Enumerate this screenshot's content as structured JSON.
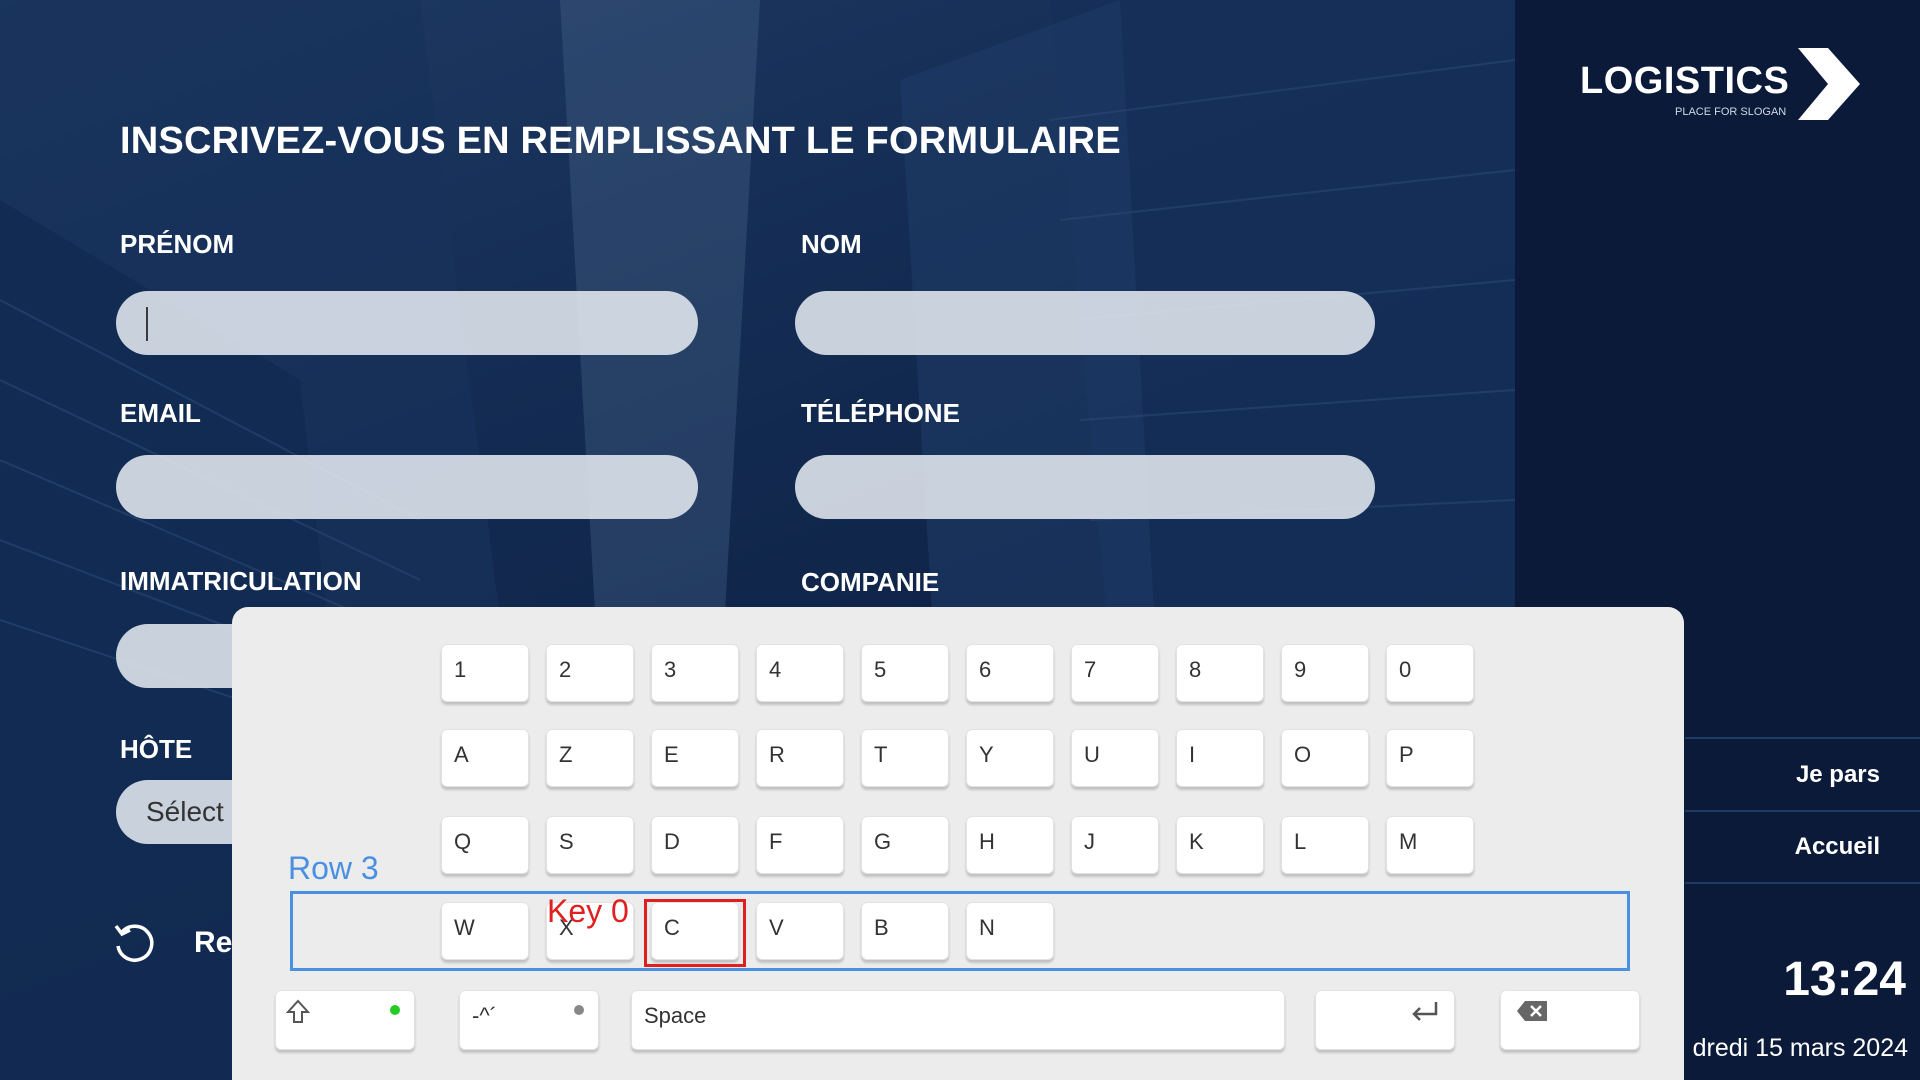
{
  "brand": {
    "name": "LOGISTICS",
    "slogan": "PLACE FOR SLOGAN"
  },
  "form": {
    "title": "INSCRIVEZ-VOUS EN REMPLISSANT LE FORMULAIRE",
    "labels": {
      "prenom": "PRÉNOM",
      "nom": "NOM",
      "email": "EMAIL",
      "telephone": "TÉLÉPHONE",
      "immatriculation": "IMMATRICULATION",
      "companie": "COMPANIE",
      "hote": "HÔTE"
    },
    "host_select_value": "Sélect",
    "reset_label": "Re"
  },
  "sidebar": {
    "links": [
      "Je pars",
      "Accueil"
    ],
    "time": "13:24",
    "date": "dredi 15 mars 2024"
  },
  "keyboard": {
    "row0": [
      "1",
      "2",
      "3",
      "4",
      "5",
      "6",
      "7",
      "8",
      "9",
      "0"
    ],
    "row1": [
      "A",
      "Z",
      "E",
      "R",
      "T",
      "Y",
      "U",
      "I",
      "O",
      "P"
    ],
    "row2": [
      "Q",
      "S",
      "D",
      "F",
      "G",
      "H",
      "J",
      "K",
      "L",
      "M"
    ],
    "row3": [
      "W",
      "X",
      "C",
      "V",
      "B",
      "N"
    ],
    "shift_icon": "shift-icon",
    "accents_label": "-^´",
    "space_label": "Space",
    "enter_icon": "enter-icon",
    "backspace_icon": "backspace-icon"
  },
  "annotations": {
    "row_label": "Row 3",
    "key_label": "Key 0"
  },
  "colors": {
    "sidebar_bg": "#0a1a38",
    "row_annotation": "#4a90e2",
    "key_annotation": "#e02020",
    "shift_indicator": "#22cc22"
  }
}
